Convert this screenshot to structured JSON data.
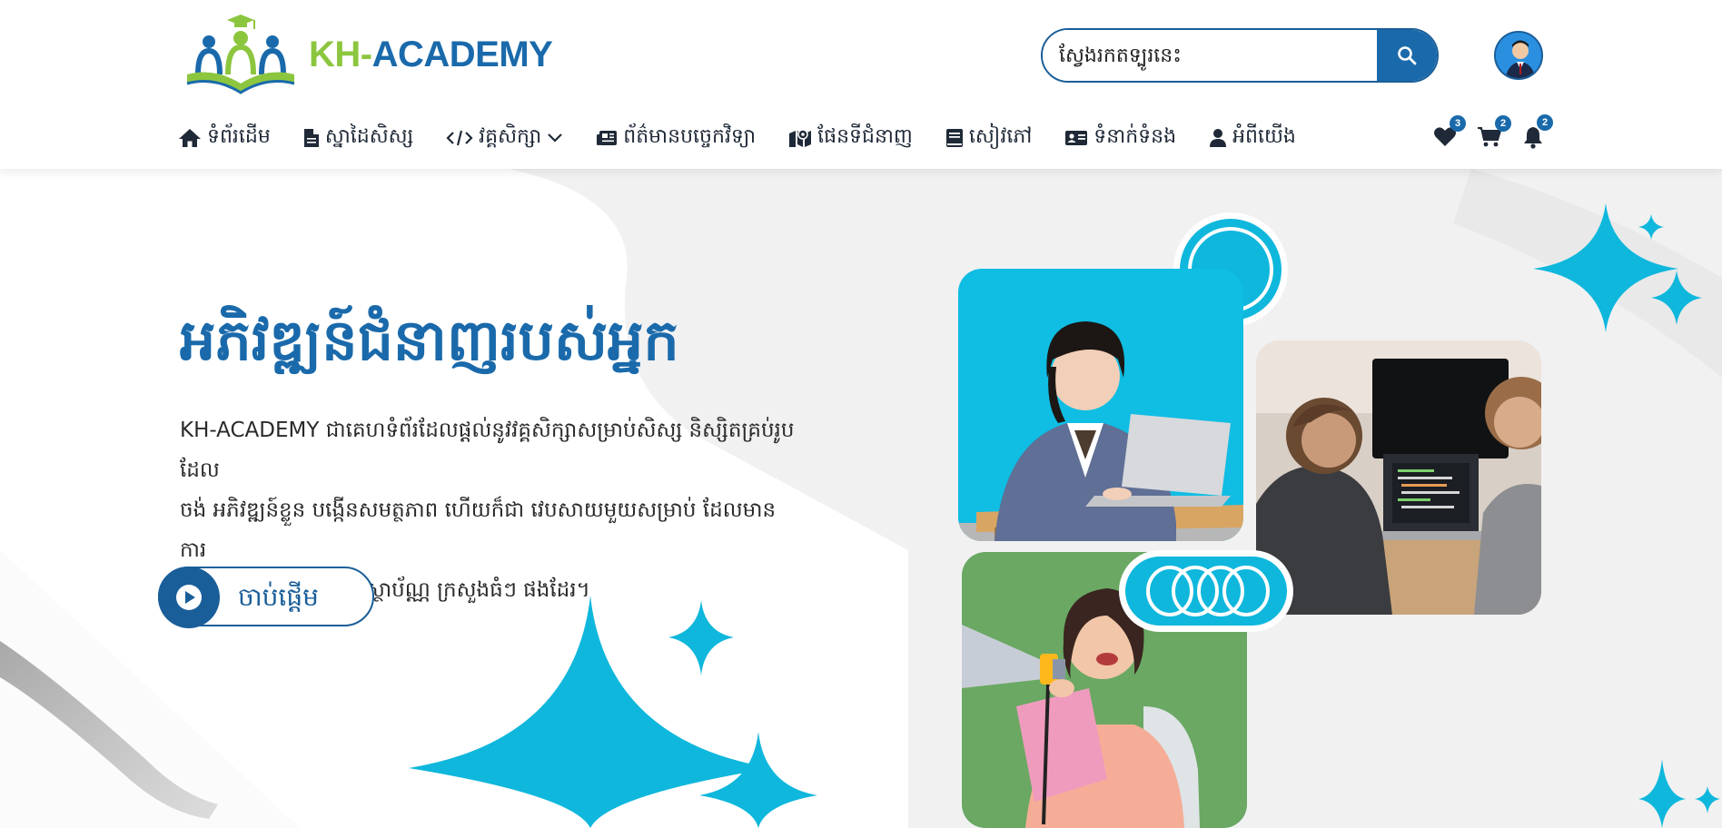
{
  "brand": {
    "prefix": "KH-",
    "name": "ACADEMY"
  },
  "search": {
    "placeholder": "ស្វែងរកតទ្បូរនេះ"
  },
  "nav": [
    {
      "icon": "home-icon",
      "label": "ទំព័រដើម"
    },
    {
      "icon": "document-icon",
      "label": "ស្នាដៃសិស្ស"
    },
    {
      "icon": "code-icon",
      "label": "វគ្គសិក្សា"
    },
    {
      "icon": "newspaper-icon",
      "label": "ព័ត៌មានបច្ចេកវិទ្យា"
    },
    {
      "icon": "map-icon",
      "label": "ផែនទីជំនាញ"
    },
    {
      "icon": "book-icon",
      "label": "សៀវភៅ"
    },
    {
      "icon": "contact-card-icon",
      "label": "ទំនាក់ទំនង"
    },
    {
      "icon": "user-icon",
      "label": "អំពីយើង"
    }
  ],
  "tools": {
    "wishlist_count": "3",
    "cart_count": "2",
    "notification_count": "2"
  },
  "hero": {
    "title": "អភិវឌ្ឍន៍ជំនាញរបស់អ្នក",
    "description_lines": [
      "KH-ACADEMY ជាគេហទំព័រដែលផ្តល់នូវវគ្គសិក្សាសម្រាប់សិស្ស និស្សិតគ្រប់រូបដែល",
      "ចង់ អភិវឌ្ឍន៍ខ្លួន បង្កើនសមត្ថភាព ហើយក៏ជា វេបសាយមួយសម្រាប់ ដែលមានការ",
      "ទទួលស្គាល់ពី ក្រុមហ៊ុន ស្ថាប័ណ្ណ ក្រសួងធំៗ ផងដែរ។"
    ],
    "cta_label": "ចាប់ផ្តើម"
  },
  "colors": {
    "brand_blue": "#1a6aab",
    "brand_green": "#8cc63f",
    "accent_cyan": "#0fb7dc",
    "photo_green_bg": "#6aa863"
  }
}
